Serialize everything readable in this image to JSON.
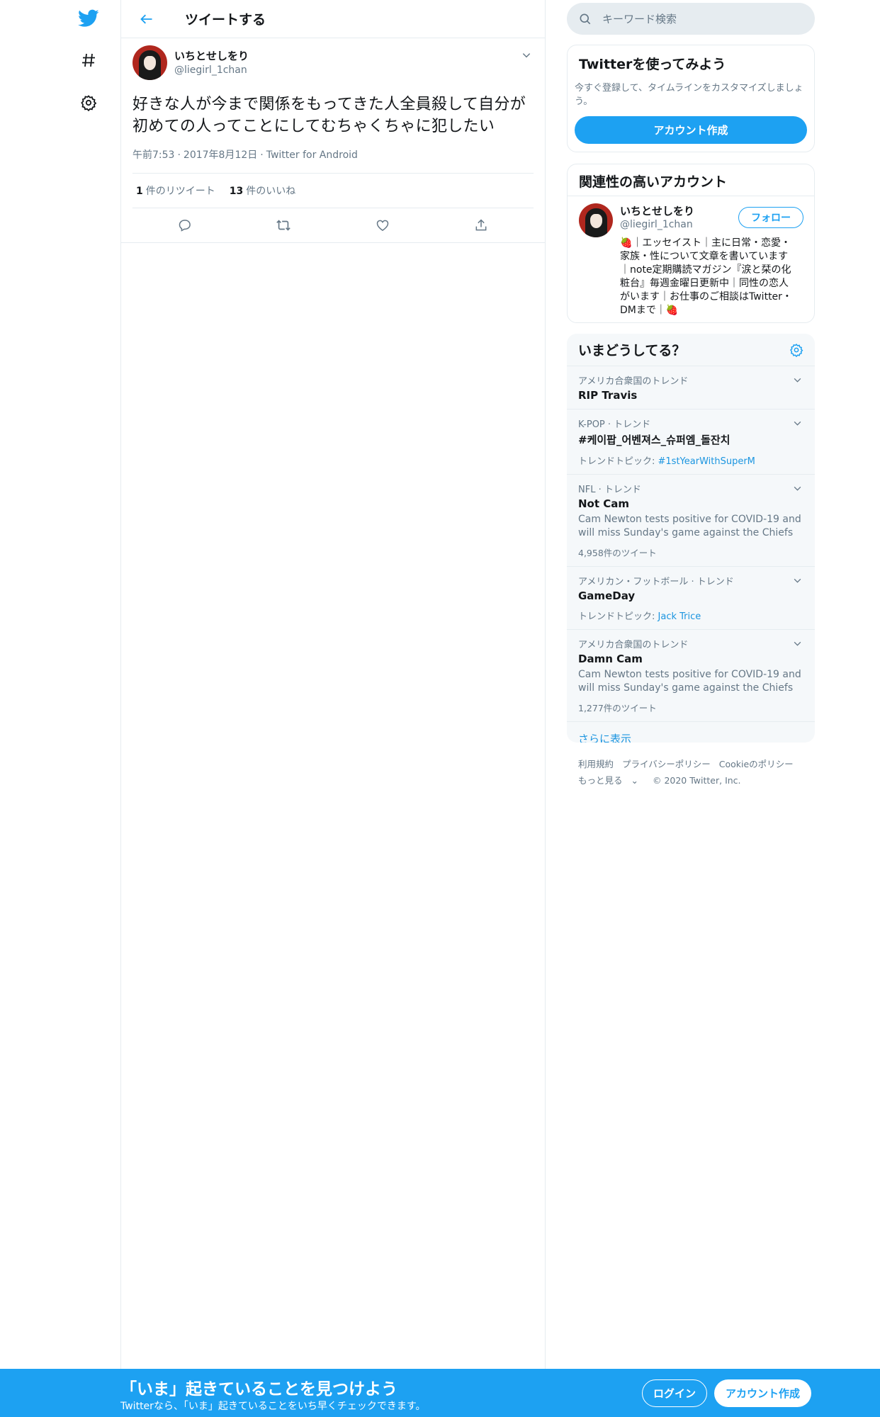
{
  "nav": {
    "icons": [
      "twitter-logo-icon",
      "hashtag-icon",
      "gear-icon"
    ]
  },
  "header": {
    "title": "ツイートする"
  },
  "tweet": {
    "author_name": "いちとせしをり",
    "author_handle": "@liegirl_1chan",
    "text": "好きな人が今まで関係をもってきた人全員殺して自分が初めての人ってことにしてむちゃくちゃに犯したい",
    "time": "午前7:53",
    "date": "2017年8月12日",
    "source": "Twitter for Android",
    "retweet_count": "1",
    "retweet_label": "件のリツイート",
    "like_count": "13",
    "like_label": "件のいいね"
  },
  "search": {
    "placeholder": "キーワード検索"
  },
  "signup_card": {
    "title": "Twitterを使ってみよう",
    "description": "今すぐ登録して、タイムラインをカスタマイズしましょう。",
    "button": "アカウント作成"
  },
  "related": {
    "title": "関連性の高いアカウント",
    "name": "いちとせしをり",
    "handle": "@liegirl_1chan",
    "follow_label": "フォロー",
    "bio": "🍓｜エッセイスト｜主に日常・恋愛・家族・性について文章を書いています｜note定期購読マガジン『涙と栞の化粧台』毎週金曜日更新中｜同性の恋人がいます｜お仕事のご相談はTwitter・DMまで｜🍓"
  },
  "trends": {
    "title": "いまどうしてる？",
    "items": [
      {
        "meta": "アメリカ合衆国のトレンド",
        "name": "RIP Travis"
      },
      {
        "meta": "K-POP · トレンド",
        "name": "#케이팝_어벤져스_슈퍼엠_돌잔치",
        "topic_label": "トレンドトピック: ",
        "topic": "#1stYearWithSuperM"
      },
      {
        "meta": "NFL · トレンド",
        "name": "Not Cam",
        "description": "Cam Newton tests positive for COVID-19 and will miss Sunday's game against the Chiefs",
        "count": "4,958件のツイート"
      },
      {
        "meta": "アメリカン・フットボール · トレンド",
        "name": "GameDay",
        "topic_label": "トレンドトピック: ",
        "topic": "Jack Trice"
      },
      {
        "meta": "アメリカ合衆国のトレンド",
        "name": "Damn Cam",
        "description": "Cam Newton tests positive for COVID-19 and will miss Sunday's game against the Chiefs",
        "count": "1,277件のツイート"
      }
    ],
    "show_more": "さらに表示"
  },
  "footer": {
    "terms": "利用規約",
    "privacy": "プライバシーポリシー",
    "cookie": "Cookieのポリシー",
    "more": "もっと見る",
    "copyright": "© 2020 Twitter, Inc."
  },
  "bottom_bar": {
    "title": "「いま」起きていることを見つけよう",
    "subtitle": "Twitterなら、「いま」起きていることをいち早くチェックできます。",
    "login": "ログイン",
    "signup": "アカウント作成"
  },
  "colors": {
    "accent": "#1da1f2",
    "link": "#1b95e0",
    "muted": "#657786",
    "border": "#e6ecf0"
  }
}
